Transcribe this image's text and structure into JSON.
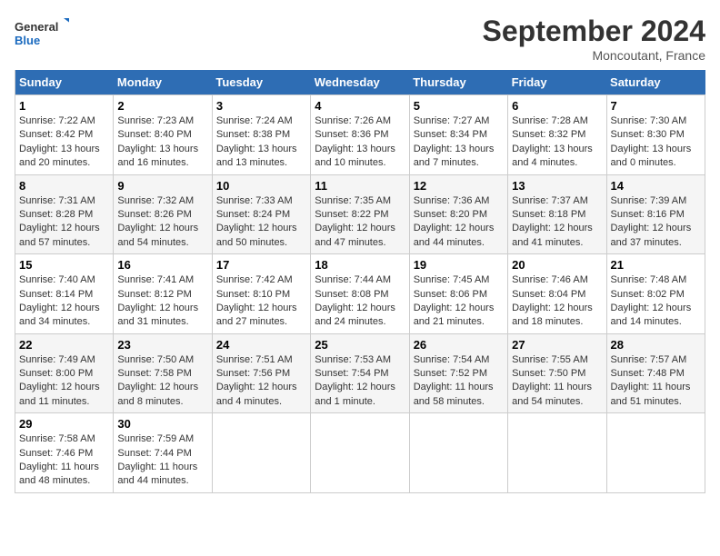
{
  "header": {
    "logo_line1": "General",
    "logo_line2": "Blue",
    "month": "September 2024",
    "location": "Moncoutant, France"
  },
  "weekdays": [
    "Sunday",
    "Monday",
    "Tuesday",
    "Wednesday",
    "Thursday",
    "Friday",
    "Saturday"
  ],
  "weeks": [
    [
      {
        "day": 1,
        "sunrise": "7:22 AM",
        "sunset": "8:42 PM",
        "daylight": "13 hours and 20 minutes"
      },
      {
        "day": 2,
        "sunrise": "7:23 AM",
        "sunset": "8:40 PM",
        "daylight": "13 hours and 16 minutes"
      },
      {
        "day": 3,
        "sunrise": "7:24 AM",
        "sunset": "8:38 PM",
        "daylight": "13 hours and 13 minutes"
      },
      {
        "day": 4,
        "sunrise": "7:26 AM",
        "sunset": "8:36 PM",
        "daylight": "13 hours and 10 minutes"
      },
      {
        "day": 5,
        "sunrise": "7:27 AM",
        "sunset": "8:34 PM",
        "daylight": "13 hours and 7 minutes"
      },
      {
        "day": 6,
        "sunrise": "7:28 AM",
        "sunset": "8:32 PM",
        "daylight": "13 hours and 4 minutes"
      },
      {
        "day": 7,
        "sunrise": "7:30 AM",
        "sunset": "8:30 PM",
        "daylight": "13 hours and 0 minutes"
      }
    ],
    [
      {
        "day": 8,
        "sunrise": "7:31 AM",
        "sunset": "8:28 PM",
        "daylight": "12 hours and 57 minutes"
      },
      {
        "day": 9,
        "sunrise": "7:32 AM",
        "sunset": "8:26 PM",
        "daylight": "12 hours and 54 minutes"
      },
      {
        "day": 10,
        "sunrise": "7:33 AM",
        "sunset": "8:24 PM",
        "daylight": "12 hours and 50 minutes"
      },
      {
        "day": 11,
        "sunrise": "7:35 AM",
        "sunset": "8:22 PM",
        "daylight": "12 hours and 47 minutes"
      },
      {
        "day": 12,
        "sunrise": "7:36 AM",
        "sunset": "8:20 PM",
        "daylight": "12 hours and 44 minutes"
      },
      {
        "day": 13,
        "sunrise": "7:37 AM",
        "sunset": "8:18 PM",
        "daylight": "12 hours and 41 minutes"
      },
      {
        "day": 14,
        "sunrise": "7:39 AM",
        "sunset": "8:16 PM",
        "daylight": "12 hours and 37 minutes"
      }
    ],
    [
      {
        "day": 15,
        "sunrise": "7:40 AM",
        "sunset": "8:14 PM",
        "daylight": "12 hours and 34 minutes"
      },
      {
        "day": 16,
        "sunrise": "7:41 AM",
        "sunset": "8:12 PM",
        "daylight": "12 hours and 31 minutes"
      },
      {
        "day": 17,
        "sunrise": "7:42 AM",
        "sunset": "8:10 PM",
        "daylight": "12 hours and 27 minutes"
      },
      {
        "day": 18,
        "sunrise": "7:44 AM",
        "sunset": "8:08 PM",
        "daylight": "12 hours and 24 minutes"
      },
      {
        "day": 19,
        "sunrise": "7:45 AM",
        "sunset": "8:06 PM",
        "daylight": "12 hours and 21 minutes"
      },
      {
        "day": 20,
        "sunrise": "7:46 AM",
        "sunset": "8:04 PM",
        "daylight": "12 hours and 18 minutes"
      },
      {
        "day": 21,
        "sunrise": "7:48 AM",
        "sunset": "8:02 PM",
        "daylight": "12 hours and 14 minutes"
      }
    ],
    [
      {
        "day": 22,
        "sunrise": "7:49 AM",
        "sunset": "8:00 PM",
        "daylight": "12 hours and 11 minutes"
      },
      {
        "day": 23,
        "sunrise": "7:50 AM",
        "sunset": "7:58 PM",
        "daylight": "12 hours and 8 minutes"
      },
      {
        "day": 24,
        "sunrise": "7:51 AM",
        "sunset": "7:56 PM",
        "daylight": "12 hours and 4 minutes"
      },
      {
        "day": 25,
        "sunrise": "7:53 AM",
        "sunset": "7:54 PM",
        "daylight": "12 hours and 1 minute"
      },
      {
        "day": 26,
        "sunrise": "7:54 AM",
        "sunset": "7:52 PM",
        "daylight": "11 hours and 58 minutes"
      },
      {
        "day": 27,
        "sunrise": "7:55 AM",
        "sunset": "7:50 PM",
        "daylight": "11 hours and 54 minutes"
      },
      {
        "day": 28,
        "sunrise": "7:57 AM",
        "sunset": "7:48 PM",
        "daylight": "11 hours and 51 minutes"
      }
    ],
    [
      {
        "day": 29,
        "sunrise": "7:58 AM",
        "sunset": "7:46 PM",
        "daylight": "11 hours and 48 minutes"
      },
      {
        "day": 30,
        "sunrise": "7:59 AM",
        "sunset": "7:44 PM",
        "daylight": "11 hours and 44 minutes"
      },
      null,
      null,
      null,
      null,
      null
    ]
  ]
}
